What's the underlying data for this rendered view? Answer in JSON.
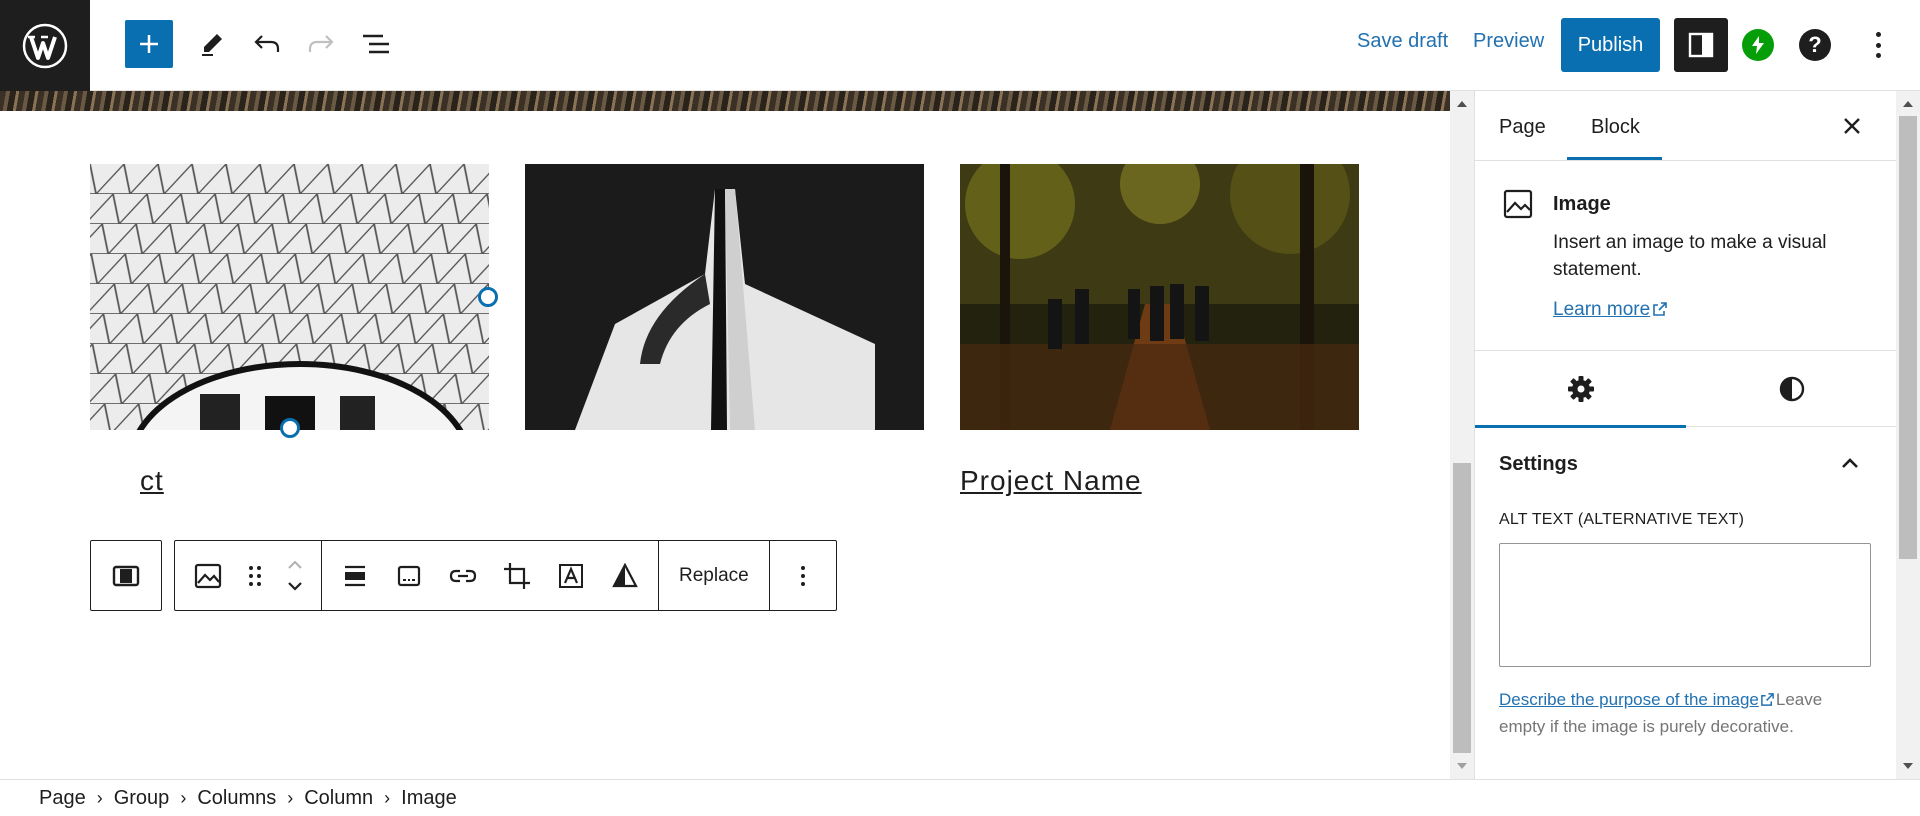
{
  "topbar": {
    "save_draft": "Save draft",
    "preview": "Preview",
    "publish": "Publish",
    "help": "?"
  },
  "canvas": {
    "project_name": "Project Name",
    "project_name_partial": "ct"
  },
  "block_toolbar": {
    "replace": "Replace"
  },
  "sidebar": {
    "tabs": [
      "Page",
      "Block"
    ],
    "active_tab": "Block",
    "block": {
      "title": "Image",
      "description": "Insert an image to make a visual statement.",
      "learn_more": "Learn more"
    },
    "settings_heading": "Settings",
    "alt_label": "ALT TEXT (ALTERNATIVE TEXT)",
    "alt_value": "",
    "help_link": "Describe the purpose of the image",
    "help_text": "Leave empty if the image is purely decorative."
  },
  "breadcrumb": [
    "Page",
    "Group",
    "Columns",
    "Column",
    "Image"
  ],
  "colors": {
    "accent": "#0a6fb0",
    "link": "#2271b1",
    "dark": "#1e1e1e",
    "jetpack": "#069e08"
  }
}
